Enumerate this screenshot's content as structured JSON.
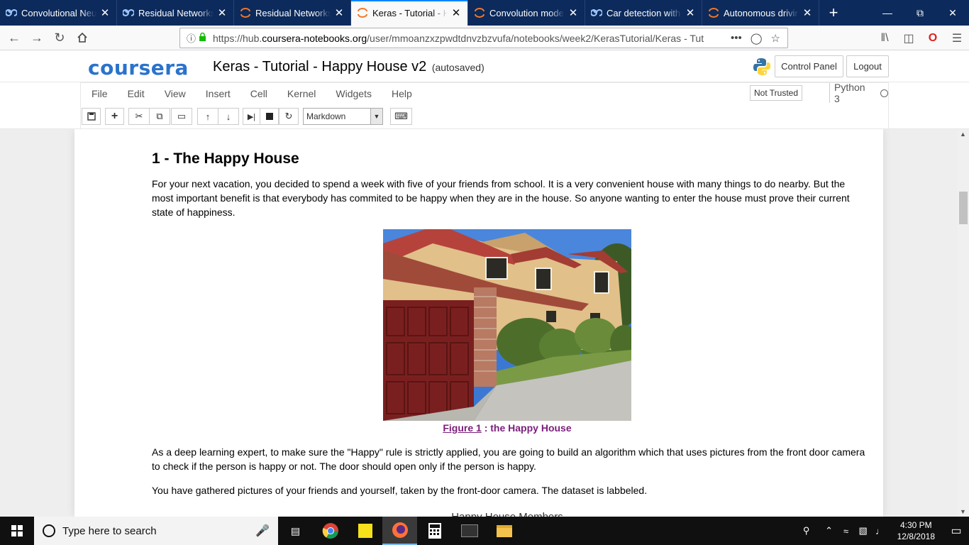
{
  "browser": {
    "tabs": [
      {
        "label": "Convolutional Neur",
        "icon": "coursera-infinity-icon",
        "active": false
      },
      {
        "label": "Residual Networks |",
        "icon": "coursera-infinity-icon",
        "active": false
      },
      {
        "label": "Residual Networks -",
        "icon": "jupyter-icon",
        "active": false
      },
      {
        "label": "Keras - Tutorial - Ha",
        "icon": "jupyter-icon",
        "active": true
      },
      {
        "label": "Convolution model",
        "icon": "jupyter-icon",
        "active": false
      },
      {
        "label": "Car detection with Y",
        "icon": "coursera-infinity-icon",
        "active": false
      },
      {
        "label": "Autonomous drivin",
        "icon": "jupyter-icon",
        "active": false
      }
    ],
    "url_prefix": "https://hub.",
    "url_domain": "coursera-notebooks.org",
    "url_path": "/user/mmoanzxzpwdtdnvzbzvufa/notebooks/week2/KerasTutorial/Keras - Tut"
  },
  "jupyter": {
    "logo": "coursera",
    "title": "Keras - Tutorial - Happy House v2",
    "autosave": "(autosaved)",
    "control_panel": "Control Panel",
    "logout": "Logout",
    "menu": [
      "File",
      "Edit",
      "View",
      "Insert",
      "Cell",
      "Kernel",
      "Widgets",
      "Help"
    ],
    "trusted": "Not Trusted",
    "kernel": "Python 3",
    "cell_type": "Markdown"
  },
  "notebook": {
    "heading": "1 - The Happy House",
    "para1": "For your next vacation, you decided to spend a week with five of your friends from school. It is a very convenient house with many things to do nearby. But the most important benefit is that everybody has commited to be happy when they are in the house. So anyone wanting to enter the house must prove their current state of happiness.",
    "figure_link": "Figure 1",
    "figure_caption": " : the Happy House",
    "para2": "As a deep learning expert, to make sure the \"Happy\" rule is strictly applied, you are going to build an algorithm which that uses pictures from the front door camera to check if the person is happy or not. The door should open only if the person is happy.",
    "para3": "You have gathered pictures of your friends and yourself, taken by the front-door camera. The dataset is labbeled.",
    "next_title": "Happy House Members"
  },
  "taskbar": {
    "search_placeholder": "Type here to search",
    "time": "4:30 PM",
    "date": "12/8/2018"
  }
}
